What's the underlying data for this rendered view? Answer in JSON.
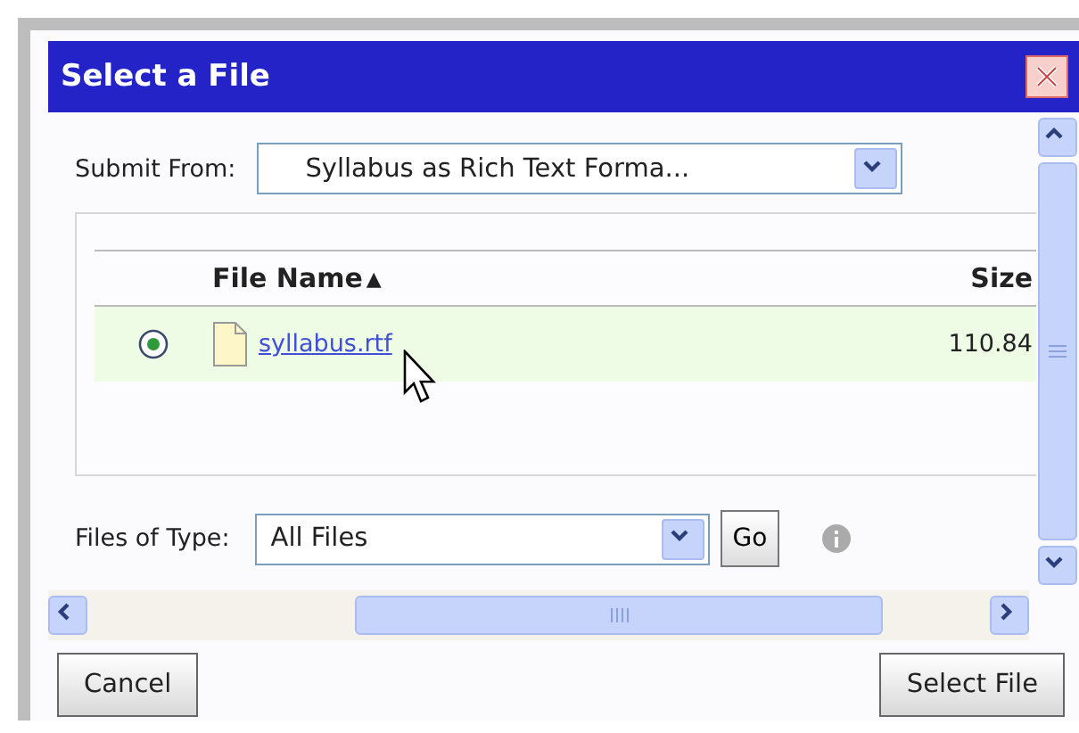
{
  "window": {
    "title": "Select a File"
  },
  "submit_from": {
    "label": "Submit From:",
    "value": "Syllabus as Rich Text Forma..."
  },
  "table": {
    "columns": [
      {
        "label": "File Name",
        "sort_mark": "▲"
      },
      {
        "label": "Size"
      }
    ],
    "rows": [
      {
        "selected": true,
        "name": "syllabus.rtf",
        "size": "110.84"
      }
    ]
  },
  "files_of_type": {
    "label": "Files of Type:",
    "value": "All Files",
    "go": "Go"
  },
  "buttons": {
    "cancel": "Cancel",
    "select": "Select File"
  }
}
